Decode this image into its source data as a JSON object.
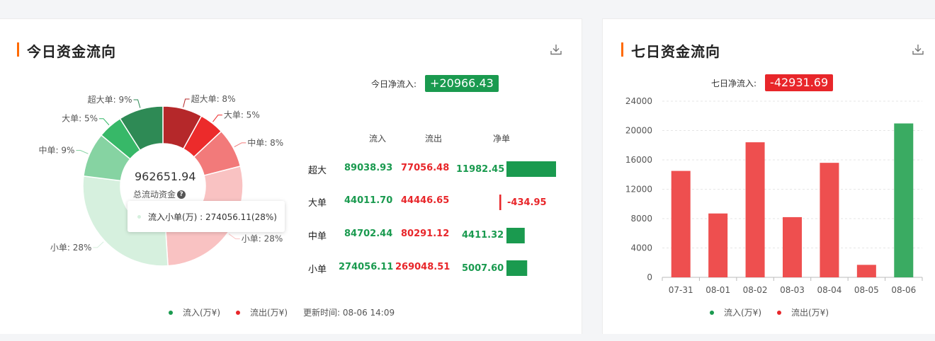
{
  "today": {
    "title": "今日资金流向",
    "net_label": "今日净流入:",
    "net_value": "+20966.43",
    "total_value": "962651.94",
    "total_label": "总流动资金",
    "help_icon": "question-circle-icon",
    "download_icon": "download-icon",
    "tooltip": {
      "text": "流入小单(万) : 274056.11(28%)"
    },
    "table": {
      "headers": [
        "流入",
        "流出",
        "净单"
      ],
      "rows": [
        {
          "label": "超大",
          "inflow": "89038.93",
          "outflow": "77056.48",
          "net": "11982.45",
          "net_num": 11982.45
        },
        {
          "label": "大单",
          "inflow": "44011.70",
          "outflow": "44446.65",
          "net": "-434.95",
          "net_num": -434.95
        },
        {
          "label": "中单",
          "inflow": "84702.44",
          "outflow": "80291.12",
          "net": "4411.32",
          "net_num": 4411.32
        },
        {
          "label": "小单",
          "inflow": "274056.11",
          "outflow": "269048.51",
          "net": "5007.60",
          "net_num": 5007.6
        }
      ]
    },
    "legend": {
      "inflow": "流入(万¥)",
      "outflow": "流出(万¥)",
      "updated": "更新时间: 08-06 14:09"
    }
  },
  "week": {
    "title": "七日资金流向",
    "net_label": "七日净流入:",
    "net_value": "-42931.69",
    "download_icon": "download-icon",
    "legend": {
      "inflow": "流入(万¥)",
      "outflow": "流出(万¥)"
    }
  },
  "colors": {
    "green": "#1a9a4f",
    "red": "#e8262a",
    "accent": "#ff6a00",
    "bar_red": "#ee4f4f",
    "bar_green": "#3aab62"
  },
  "chart_data": [
    {
      "type": "pie",
      "variant": "donut",
      "center_value": "962651.94",
      "center_label": "总流动资金",
      "slices": [
        {
          "label": "超大单: 8%",
          "name": "流出超大单",
          "value": 8,
          "color": "#b5282a"
        },
        {
          "label": "大单: 5%",
          "name": "流出大单",
          "value": 5,
          "color": "#ec2b2b"
        },
        {
          "label": "中单: 8%",
          "name": "流出中单",
          "value": 8,
          "color": "#f27a7a"
        },
        {
          "label": "小单: 28%",
          "name": "流出小单",
          "value": 28,
          "color": "#f9c2c2"
        },
        {
          "label": "小单: 28%",
          "name": "流入小单",
          "value": 28,
          "color": "#d6f0de"
        },
        {
          "label": "中单: 9%",
          "name": "流入中单",
          "value": 9,
          "color": "#86d3a2"
        },
        {
          "label": "大单: 5%",
          "name": "流入大单",
          "value": 5,
          "color": "#37b868"
        },
        {
          "label": "超大单: 9%",
          "name": "流入超大单",
          "value": 9,
          "color": "#2e8a55"
        }
      ],
      "legend": [
        "流入(万¥)",
        "流出(万¥)"
      ]
    },
    {
      "type": "bar",
      "categories": [
        "07-31",
        "08-01",
        "08-02",
        "08-03",
        "08-04",
        "08-05",
        "08-06"
      ],
      "values": [
        14500,
        8700,
        18400,
        8200,
        15600,
        1700,
        20966
      ],
      "direction": [
        "out",
        "out",
        "out",
        "out",
        "out",
        "out",
        "in"
      ],
      "ylim": [
        0,
        24000
      ],
      "yticks": [
        0,
        4000,
        8000,
        12000,
        16000,
        20000,
        24000
      ],
      "grid": true,
      "legend": [
        "流入(万¥)",
        "流出(万¥)"
      ],
      "legend_position": "bottom"
    }
  ]
}
